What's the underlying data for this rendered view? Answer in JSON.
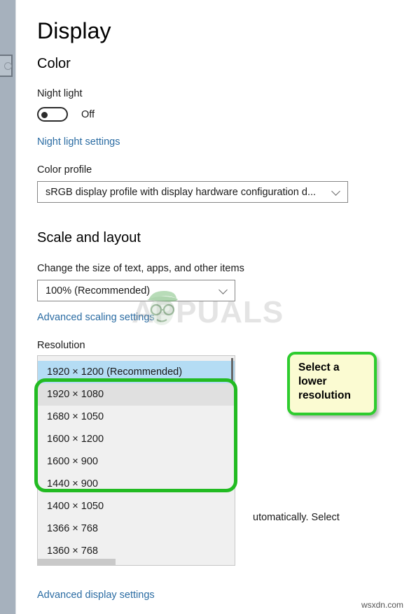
{
  "page": {
    "title": "Display"
  },
  "sections": {
    "color": {
      "heading": "Color",
      "night_light_label": "Night light",
      "night_light_state": "Off",
      "night_light_on": false,
      "night_light_link": "Night light settings",
      "color_profile_label": "Color profile",
      "color_profile_value": "sRGB display profile with display hardware configuration d..."
    },
    "scale_layout": {
      "heading": "Scale and layout",
      "change_size_label": "Change the size of text, apps, and other items",
      "change_size_value": "100% (Recommended)",
      "advanced_scaling_link": "Advanced scaling settings",
      "resolution_label": "Resolution"
    }
  },
  "resolution_dropdown": {
    "options": [
      {
        "label": "1920 × 1200 (Recommended)",
        "state": "selected"
      },
      {
        "label": "1920 × 1080",
        "state": "hover"
      },
      {
        "label": "1680 × 1050",
        "state": "normal"
      },
      {
        "label": "1600 × 1200",
        "state": "normal"
      },
      {
        "label": "1600 × 900",
        "state": "normal"
      },
      {
        "label": "1440 × 900",
        "state": "normal"
      },
      {
        "label": "1400 × 1050",
        "state": "normal"
      },
      {
        "label": "1366 × 768",
        "state": "normal"
      },
      {
        "label": "1360 × 768",
        "state": "normal"
      }
    ]
  },
  "annotation": {
    "callout_text": "Select a\nlower\nresolution",
    "highlight_color": "#22bb22",
    "callout_bg": "#fbfbd2",
    "callout_border": "#2ecc2e"
  },
  "background": {
    "partial_text": "utomatically. Select",
    "advanced_display_link": "Advanced display settings"
  },
  "watermarks": {
    "brand": "APPUALS",
    "site": "wsxdn.com"
  }
}
